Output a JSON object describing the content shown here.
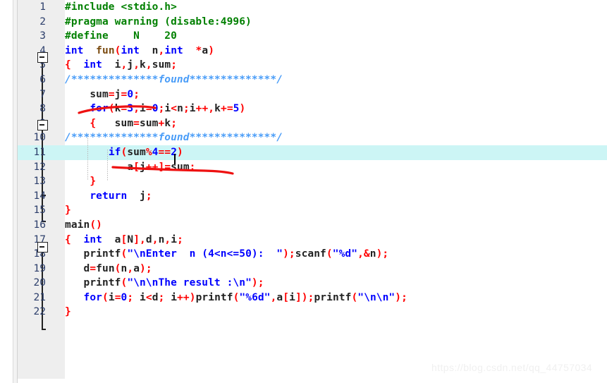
{
  "editor": {
    "app": "code-editor",
    "highlighted_line": 11,
    "caret_line": 11,
    "colors": {
      "background": "#ffffff",
      "gutter": "#eeeeee",
      "line_number": "#2c3e6b",
      "current_line_highlight": "#ccf5f5",
      "comment": "#4a9df8",
      "keyword": "#0000ff",
      "preprocessor": "#008000",
      "punctuation": "#ff0000",
      "identifier": "#222222",
      "annotation_pen": "#ee1111",
      "watermark": "#f0f0f0"
    },
    "lines": [
      {
        "n": "1",
        "text": "#include <stdio.h>"
      },
      {
        "n": "2",
        "text": "#pragma warning (disable:4996)"
      },
      {
        "n": "3",
        "text": "#define    N    20"
      },
      {
        "n": "4",
        "text": "int  fun(int  n,int  *a)"
      },
      {
        "n": "5",
        "text": "{  int  i,j,k,sum;"
      },
      {
        "n": "6",
        "text": "/**************found**************/"
      },
      {
        "n": "7",
        "text": "    sum=j=0;"
      },
      {
        "n": "8",
        "text": "    for(k=3,i=0;i<n;i++,k+=5)"
      },
      {
        "n": "9",
        "text": "    {   sum=sum+k;"
      },
      {
        "n": "10",
        "text": "/**************found**************/"
      },
      {
        "n": "11",
        "text": "       if(sum%4==2)"
      },
      {
        "n": "12",
        "text": "          a[j++]=sum;"
      },
      {
        "n": "13",
        "text": "    }"
      },
      {
        "n": "14",
        "text": "    return  j;"
      },
      {
        "n": "15",
        "text": "}"
      },
      {
        "n": "16",
        "text": "main()"
      },
      {
        "n": "17",
        "text": "{  int  a[N],d,n,i;"
      },
      {
        "n": "18",
        "text": "   printf(\"\\nEnter  n (4<n<=50):  \");scanf(\"%d\",&n);"
      },
      {
        "n": "19",
        "text": "   d=fun(n,a);"
      },
      {
        "n": "20",
        "text": "   printf(\"\\n\\nThe result :\\n\");"
      },
      {
        "n": "21",
        "text": "   for(i=0; i<d; i++)printf(\"%6d\",a[i]);printf(\"\\n\\n\");"
      },
      {
        "n": "22",
        "text": "}"
      }
    ],
    "fold_markers": [
      {
        "line": "5",
        "state": "expanded"
      },
      {
        "line": "9",
        "state": "expanded"
      },
      {
        "line": "17",
        "state": "expanded"
      }
    ],
    "annotations": [
      {
        "kind": "underline",
        "target": "sum=j=0;"
      },
      {
        "kind": "strikethrough",
        "target": "a[j++]=sum;"
      }
    ]
  },
  "watermark": {
    "text": "https://blog.csdn.net/qq_44757034"
  }
}
